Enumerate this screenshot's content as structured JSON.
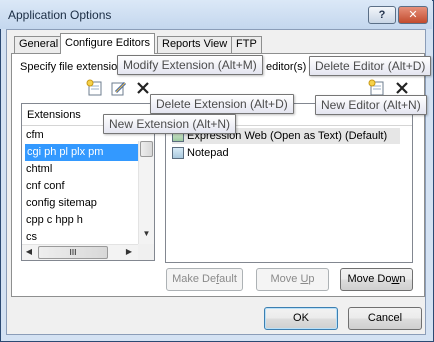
{
  "window": {
    "title": "Application Options",
    "help_label": "?",
    "close_label": "✕"
  },
  "tabs": [
    {
      "label": "General"
    },
    {
      "label": "Configure Editors"
    },
    {
      "label": "Reports View"
    },
    {
      "label": "FTP"
    }
  ],
  "panel": {
    "description_left": "Specify file extensio",
    "description_right": "editor(s)"
  },
  "extensions": {
    "header": "Extensions",
    "items": [
      "cfm",
      "cgi ph pl plx pm",
      "chtml",
      "cnf conf",
      "config sitemap",
      "cpp c hpp h",
      "cs"
    ],
    "selected_index": 1,
    "scroll_h_grip": "III"
  },
  "editors": {
    "items": [
      {
        "label": "Expression Web (Open as Text) (Default)"
      },
      {
        "label": "Notepad"
      }
    ]
  },
  "tooltips": {
    "modify_extension": "Modify Extension (Alt+M)",
    "delete_editor": "Delete Editor (Alt+D)",
    "delete_extension": "Delete Extension (Alt+D)",
    "new_editor": "New Editor (Alt+N)",
    "new_extension": "New Extension (Alt+N)"
  },
  "buttons": {
    "make_default": {
      "pre": "Make De",
      "key": "f",
      "post": "ault"
    },
    "move_up": {
      "pre": "Move ",
      "key": "U",
      "post": "p"
    },
    "move_down": {
      "pre": "Move Do",
      "key": "w",
      "post": "n"
    },
    "ok": "OK",
    "cancel": "Cancel"
  }
}
